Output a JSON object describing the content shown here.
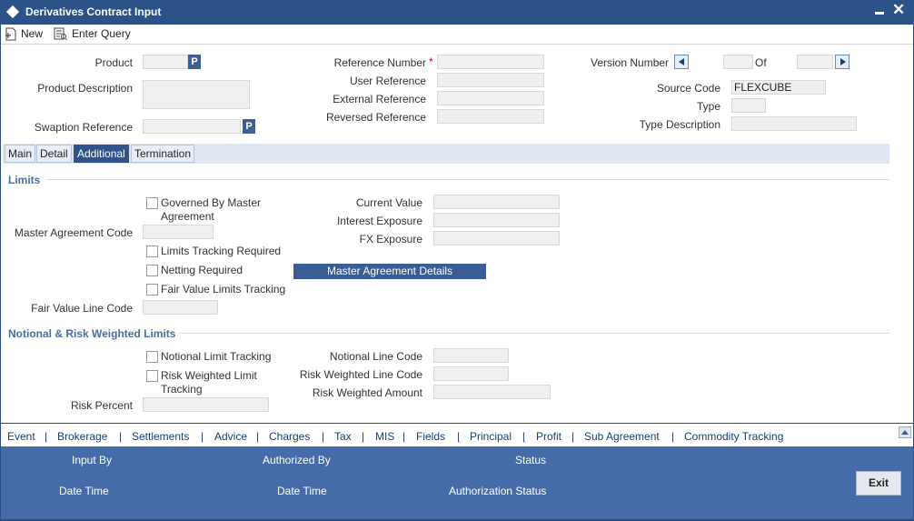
{
  "window": {
    "title": "Derivatives Contract Input",
    "minimize_label": "—",
    "close_label": "✕"
  },
  "toolbar": {
    "new_label": "New",
    "enter_query_label": "Enter Query"
  },
  "header": {
    "product_label": "Product",
    "product_value": "",
    "p_label": "P",
    "product_description_label": "Product Description",
    "swaption_reference_label": "Swaption Reference",
    "reference_number_label": "Reference Number",
    "required_mark": "*",
    "user_reference_label": "User Reference",
    "external_reference_label": "External Reference",
    "reversed_reference_label": "Reversed Reference",
    "version_number_label": "Version Number",
    "of_label": "Of",
    "source_code_label": "Source Code",
    "source_code_value": "FLEXCUBE",
    "type_label": "Type",
    "type_description_label": "Type Description"
  },
  "tabs": [
    {
      "label": "Main"
    },
    {
      "label": "Detail"
    },
    {
      "label": "Additional"
    },
    {
      "label": "Termination"
    }
  ],
  "limits": {
    "section_title": "Limits",
    "governed_by_master_line1": "Governed By Master",
    "governed_by_master_line2": "Agreement",
    "master_agreement_code_label": "Master Agreement Code",
    "limits_tracking_label": "Limits Tracking Required",
    "netting_required_label": "Netting Required",
    "fair_value_limits_label": "Fair Value Limits Tracking",
    "fair_value_line_code_label": "Fair Value Line Code",
    "current_value_label": "Current Value",
    "interest_exposure_label": "Interest Exposure",
    "fx_exposure_label": "FX Exposure",
    "master_agreement_details_label": "Master Agreement Details"
  },
  "notional": {
    "section_title": "Notional & Risk Weighted Limits",
    "notional_limit_tracking_label": "Notional Limit Tracking",
    "risk_weighted_line1": "Risk Weighted Limit",
    "risk_weighted_line2": "Tracking",
    "risk_percent_label": "Risk Percent",
    "notional_line_code_label": "Notional Line Code",
    "risk_weighted_line_code_label": "Risk Weighted Line Code",
    "risk_weighted_amount_label": "Risk Weighted Amount"
  },
  "bottom_nav": {
    "separator": "|",
    "items": [
      {
        "label": "Event"
      },
      {
        "label": "Brokerage"
      },
      {
        "label": "Settlements"
      },
      {
        "label": "Advice"
      },
      {
        "label": "Charges"
      },
      {
        "label": "Tax"
      },
      {
        "label": "MIS"
      },
      {
        "label": "Fields"
      },
      {
        "label": "Principal"
      },
      {
        "label": "Profit"
      },
      {
        "label": "Sub Agreement"
      },
      {
        "label": "Commodity Tracking"
      }
    ]
  },
  "footer": {
    "input_by_label": "Input By",
    "authorized_by_label": "Authorized By",
    "status_label": "Status",
    "date_time_label": "Date Time",
    "date_time_label_2": "Date Time",
    "authorization_status_label": "Authorization Status",
    "exit_label": "Exit"
  }
}
